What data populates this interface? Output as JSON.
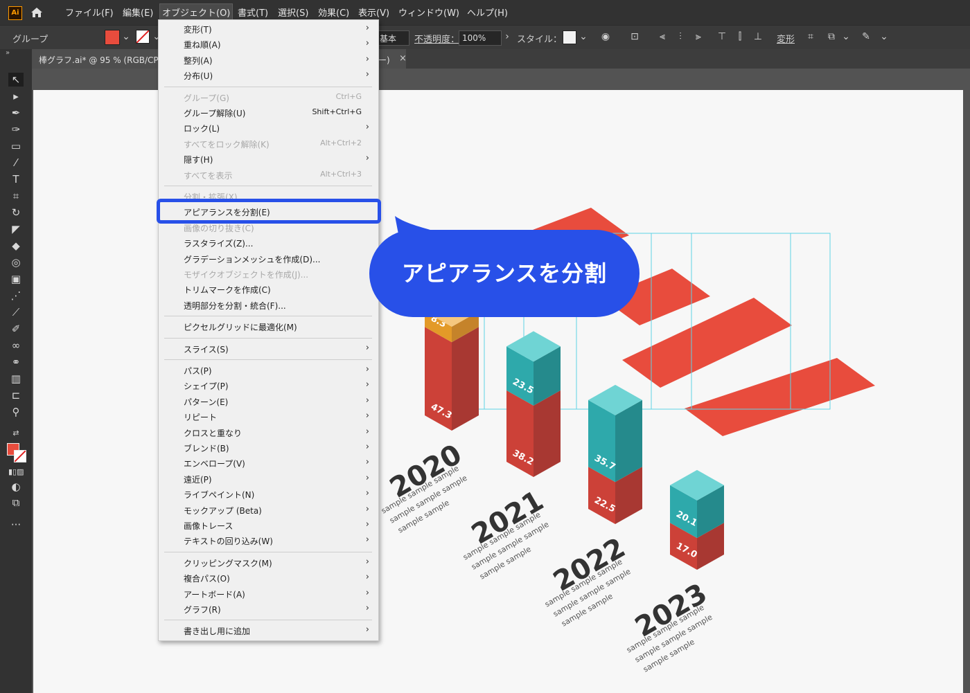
{
  "app": {
    "logo": "Ai",
    "home_icon": "home-icon"
  },
  "menubar": {
    "items": [
      "ファイル(F)",
      "編集(E)",
      "オブジェクト(O)",
      "書式(T)",
      "選択(S)",
      "効果(C)",
      "表示(V)",
      "ウィンドウ(W)",
      "ヘルプ(H)"
    ],
    "active": "オブジェクト(O)"
  },
  "control_bar": {
    "selection_label": "グループ",
    "fill_color": "#e84c3d",
    "stroke_label": "基本",
    "opacity_label": "不透明度：",
    "opacity_value": "100%",
    "style_label": "スタイル：",
    "transform_label": "変形"
  },
  "document_tab": {
    "title": "棒グラフ.ai* @ 95 % (RGB/CPU ビ",
    "title_tail": "ー)",
    "close": "×"
  },
  "object_menu": [
    {
      "label": "変形(T)",
      "submenu": true
    },
    {
      "label": "重ね順(A)",
      "submenu": true
    },
    {
      "label": "整列(A)",
      "submenu": true
    },
    {
      "label": "分布(U)",
      "submenu": true
    },
    {
      "sep": true
    },
    {
      "label": "グループ(G)",
      "shortcut": "Ctrl+G",
      "disabled": true
    },
    {
      "label": "グループ解除(U)",
      "shortcut": "Shift+Ctrl+G"
    },
    {
      "label": "ロック(L)",
      "submenu": true
    },
    {
      "label": "すべてをロック解除(K)",
      "shortcut": "Alt+Ctrl+2",
      "disabled": true
    },
    {
      "label": "隠す(H)",
      "submenu": true
    },
    {
      "label": "すべてを表示",
      "shortcut": "Alt+Ctrl+3",
      "disabled": true
    },
    {
      "sep": true
    },
    {
      "label": "分割・拡張(X)...",
      "disabled": true
    },
    {
      "label": "アピアランスを分割(E)"
    },
    {
      "label": "画像の切り抜き(C)",
      "disabled": true
    },
    {
      "label": "ラスタライズ(Z)..."
    },
    {
      "label": "グラデーションメッシュを作成(D)..."
    },
    {
      "label": "モザイクオブジェクトを作成(J)...",
      "disabled": true
    },
    {
      "label": "トリムマークを作成(C)"
    },
    {
      "label": "透明部分を分割・統合(F)..."
    },
    {
      "sep": true
    },
    {
      "label": "ピクセルグリッドに最適化(M)"
    },
    {
      "sep": true
    },
    {
      "label": "スライス(S)",
      "submenu": true
    },
    {
      "sep": true
    },
    {
      "label": "パス(P)",
      "submenu": true
    },
    {
      "label": "シェイプ(P)",
      "submenu": true
    },
    {
      "label": "パターン(E)",
      "submenu": true
    },
    {
      "label": "リピート",
      "submenu": true
    },
    {
      "label": "クロスと重なり",
      "submenu": true
    },
    {
      "label": "ブレンド(B)",
      "submenu": true
    },
    {
      "label": "エンベロープ(V)",
      "submenu": true
    },
    {
      "label": "遠近(P)",
      "submenu": true
    },
    {
      "label": "ライブペイント(N)",
      "submenu": true
    },
    {
      "label": "モックアップ (Beta)",
      "submenu": true
    },
    {
      "label": "画像トレース",
      "submenu": true
    },
    {
      "label": "テキストの回り込み(W)",
      "submenu": true
    },
    {
      "sep": true
    },
    {
      "label": "クリッピングマスク(M)",
      "submenu": true
    },
    {
      "label": "複合パス(O)",
      "submenu": true
    },
    {
      "label": "アートボード(A)",
      "submenu": true
    },
    {
      "label": "グラフ(R)",
      "submenu": true
    },
    {
      "sep": true
    },
    {
      "label": "書き出し用に追加",
      "submenu": true
    }
  ],
  "callout": {
    "text": "アピアランスを分割"
  },
  "chart_data": {
    "type": "bar",
    "categories": [
      "2020",
      "2021",
      "2022",
      "2023"
    ],
    "series": [
      {
        "values": [
          47.3,
          38.2,
          22.5,
          17.0
        ]
      },
      {
        "values": [
          null,
          23.5,
          35.7,
          20.1
        ]
      },
      {
        "values": [
          8.3,
          null,
          null,
          null
        ]
      }
    ],
    "data_labels": [
      [
        "47.3",
        null,
        "8.3"
      ],
      [
        "38.2",
        "23.5",
        null
      ],
      [
        "22.5",
        "35.7",
        null
      ],
      [
        "17.0",
        "20.1",
        null
      ]
    ],
    "caption_lines": [
      "sample sample sample",
      "sample sample sample",
      "sample sample"
    ],
    "colors": {
      "red_front": "#cc4138",
      "red_side": "#a83832",
      "teal_front": "#2ea9ab",
      "teal_side": "#258a8c",
      "teal_top": "#6fd4d4",
      "orange_front": "#e39a28",
      "orange_side": "#c5832a",
      "orange_top": "#f5c77f",
      "band": "#e84c3d"
    }
  }
}
